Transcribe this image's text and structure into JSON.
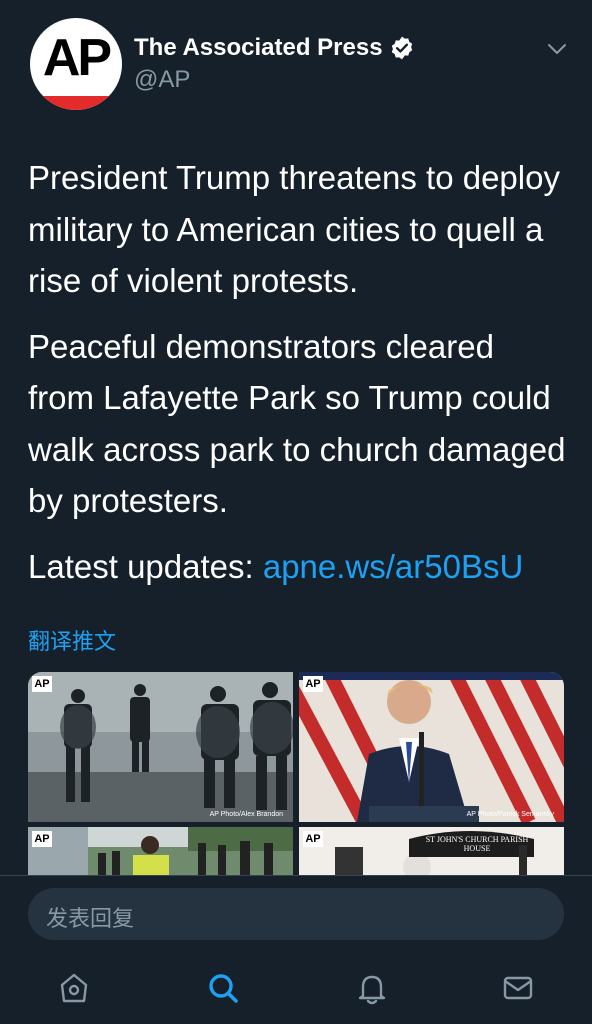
{
  "account": {
    "name": "The Associated Press",
    "handle": "@AP",
    "avatar_text": "AP"
  },
  "tweet": {
    "paragraphs": [
      "President Trump threatens to deploy military to American cities to quell a rise of violent protests.",
      "Peaceful demonstrators cleared from Lafayette Park so Trump could walk across park to church damaged by protesters."
    ],
    "updates_label": "Latest updates: ",
    "link": "apne.ws/ar50BsU"
  },
  "translate_label": "翻译推文",
  "media": {
    "images": [
      {
        "badge": "AP",
        "credit": "AP Photo/Alex Brandon"
      },
      {
        "badge": "AP",
        "credit": "AP Photo/Patrick Semansky"
      },
      {
        "badge": "AP",
        "credit": ""
      },
      {
        "badge": "AP",
        "sign": "ST JOHN'S CHURCH PARISH HOUSE",
        "credit": ""
      }
    ]
  },
  "reply": {
    "placeholder": "发表回复"
  },
  "tabbar": {
    "icons": [
      "home-icon",
      "search-icon",
      "notifications-icon",
      "messages-icon"
    ],
    "active": "search-icon"
  },
  "colors": {
    "background": "#15202b",
    "accent": "#1da1f2",
    "secondary_text": "#8899a6",
    "input_bg": "#253341"
  }
}
